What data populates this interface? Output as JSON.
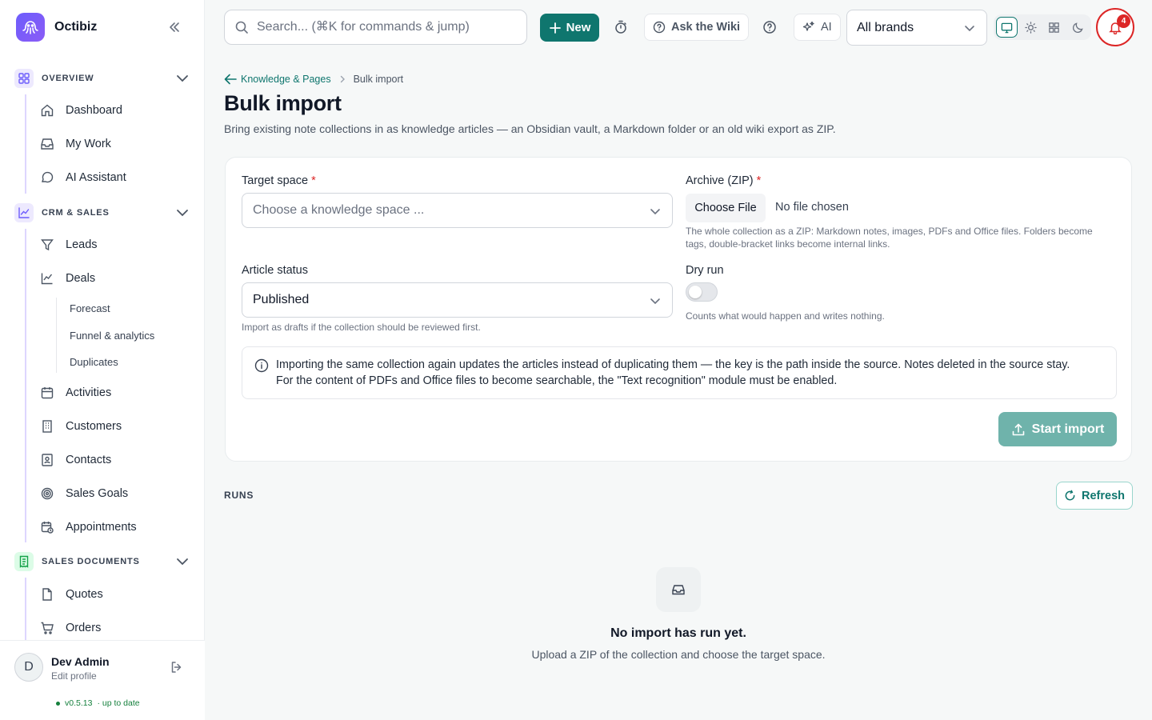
{
  "app": {
    "name": "Octibiz"
  },
  "sidebar": {
    "sections": [
      {
        "label": "OVERVIEW",
        "items": [
          "Dashboard",
          "My Work",
          "AI Assistant"
        ]
      },
      {
        "label": "CRM & SALES",
        "items": [
          "Leads",
          "Deals",
          "Activities",
          "Customers",
          "Contacts",
          "Sales Goals",
          "Appointments"
        ],
        "sub_items": [
          "Forecast",
          "Funnel & analytics",
          "Duplicates"
        ]
      },
      {
        "label": "SALES DOCUMENTS",
        "items": [
          "Quotes",
          "Orders"
        ]
      }
    ],
    "user": {
      "initial": "D",
      "name": "Dev Admin",
      "edit": "Edit profile"
    },
    "version": "v0.5.13",
    "version_status": "· up to date"
  },
  "topbar": {
    "search_placeholder": "Search... (⌘K for commands & jump)",
    "new_label": "New",
    "wiki_label": "Ask the Wiki",
    "ai_label": "AI",
    "brand_filter": "All brands",
    "notifications": "4"
  },
  "breadcrumb": {
    "parent": "Knowledge & Pages",
    "current": "Bulk import"
  },
  "page": {
    "title": "Bulk import",
    "subtitle": "Bring existing note collections in as knowledge articles — an Obsidian vault, a Markdown folder or an old wiki export as ZIP."
  },
  "form": {
    "target_label": "Target space",
    "target_placeholder": "Choose a knowledge space ...",
    "archive_label": "Archive (ZIP)",
    "choose_file": "Choose File",
    "no_file": "No file chosen",
    "archive_hint_1": "The whole collection as a ZIP: Markdown notes, images, PDFs and Office files. Folders become",
    "archive_hint_2": "tags, double-bracket links become internal links.",
    "status_label": "Article status",
    "status_value": "Published",
    "status_hint": "Import as drafts if the collection should be reviewed first.",
    "dry_run_label": "Dry run",
    "dry_run_hint": "Counts what would happen and writes nothing.",
    "dry_run_on": false,
    "info_1": "Importing the same collection again updates the articles instead of duplicating them — the key is the path inside the source. Notes deleted in the source stay.",
    "info_2": "For the content of PDFs and Office files to become searchable, the \"Text recognition\" module must be enabled.",
    "start_label": "Start import",
    "required_mark": "*"
  },
  "runs": {
    "label": "RUNS",
    "refresh_label": "Refresh",
    "empty_title": "No import has run yet.",
    "empty_sub": "Upload a ZIP of the collection and choose the target space."
  },
  "colors": {
    "accent": "#0f766e",
    "danger": "#dc2626",
    "brand": "#6d5dfc"
  }
}
